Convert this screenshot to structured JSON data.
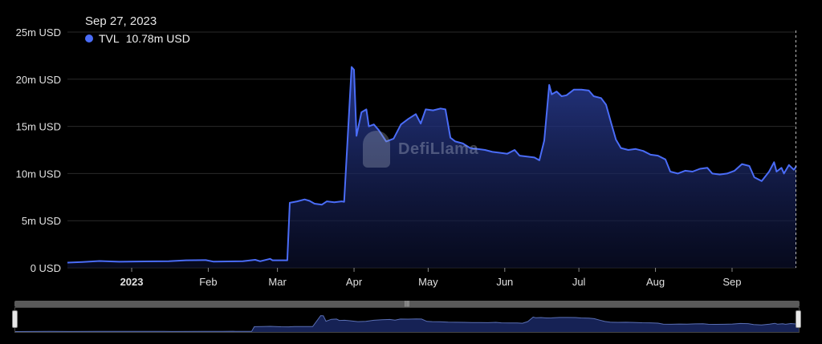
{
  "tooltip": {
    "date": "Sep 27, 2023",
    "series_name": "TVL",
    "value": "10.78m USD"
  },
  "watermark": {
    "text": "DefiLlama"
  },
  "colors": {
    "line": "#4a6cf7",
    "background": "#000000",
    "grid": "#2a2a2a",
    "slider": "#5a5a5a"
  },
  "chart_data": {
    "type": "area",
    "y_ticks": [
      {
        "value": 0,
        "label": "0 USD"
      },
      {
        "value": 5,
        "label": "5m USD"
      },
      {
        "value": 10,
        "label": "10m USD"
      },
      {
        "value": 15,
        "label": "15m USD"
      },
      {
        "value": 20,
        "label": "20m USD"
      },
      {
        "value": 25,
        "label": "25m USD"
      }
    ],
    "x_ticks": [
      {
        "day": 0,
        "label": "2023",
        "bold": true
      },
      {
        "day": 31,
        "label": "Feb"
      },
      {
        "day": 59,
        "label": "Mar"
      },
      {
        "day": 90,
        "label": "Apr"
      },
      {
        "day": 120,
        "label": "May"
      },
      {
        "day": 151,
        "label": "Jun"
      },
      {
        "day": 181,
        "label": "Jul"
      },
      {
        "day": 212,
        "label": "Aug"
      },
      {
        "day": 243,
        "label": "Sep"
      }
    ],
    "x_range": [
      -26,
      269
    ],
    "ylim": [
      0,
      25
    ],
    "grid": true,
    "series": [
      {
        "name": "TVL",
        "points": [
          [
            -26,
            0.55
          ],
          [
            -20,
            0.62
          ],
          [
            -13,
            0.72
          ],
          [
            -5,
            0.65
          ],
          [
            5,
            0.68
          ],
          [
            15,
            0.7
          ],
          [
            22,
            0.8
          ],
          [
            30,
            0.82
          ],
          [
            33,
            0.66
          ],
          [
            45,
            0.7
          ],
          [
            50,
            0.85
          ],
          [
            52,
            0.7
          ],
          [
            56,
            0.95
          ],
          [
            57,
            0.8
          ],
          [
            63,
            0.8
          ],
          [
            64,
            6.9
          ],
          [
            67,
            7.05
          ],
          [
            70,
            7.25
          ],
          [
            72,
            7.1
          ],
          [
            74,
            6.8
          ],
          [
            77,
            6.7
          ],
          [
            79,
            7.05
          ],
          [
            82,
            6.95
          ],
          [
            85,
            7.05
          ],
          [
            86,
            7.0
          ],
          [
            89,
            21.3
          ],
          [
            90,
            21.0
          ],
          [
            91,
            14.0
          ],
          [
            93,
            16.5
          ],
          [
            95,
            16.8
          ],
          [
            96,
            15.0
          ],
          [
            98,
            15.2
          ],
          [
            100,
            14.6
          ],
          [
            103,
            13.4
          ],
          [
            106,
            13.7
          ],
          [
            109,
            15.2
          ],
          [
            112,
            15.8
          ],
          [
            115,
            16.3
          ],
          [
            117,
            15.3
          ],
          [
            119,
            16.8
          ],
          [
            122,
            16.7
          ],
          [
            125,
            16.9
          ],
          [
            127,
            16.8
          ],
          [
            129,
            13.8
          ],
          [
            131,
            13.4
          ],
          [
            134,
            13.2
          ],
          [
            137,
            12.7
          ],
          [
            140,
            12.6
          ],
          [
            143,
            12.5
          ],
          [
            146,
            12.3
          ],
          [
            149,
            12.2
          ],
          [
            152,
            12.1
          ],
          [
            155,
            12.5
          ],
          [
            157,
            11.9
          ],
          [
            160,
            11.8
          ],
          [
            163,
            11.7
          ],
          [
            165,
            11.4
          ],
          [
            167,
            13.5
          ],
          [
            169,
            19.4
          ],
          [
            170,
            18.4
          ],
          [
            172,
            18.7
          ],
          [
            174,
            18.2
          ],
          [
            176,
            18.3
          ],
          [
            179,
            18.9
          ],
          [
            182,
            18.9
          ],
          [
            185,
            18.8
          ],
          [
            187,
            18.2
          ],
          [
            190,
            18.0
          ],
          [
            192,
            17.3
          ],
          [
            194,
            15.4
          ],
          [
            196,
            13.6
          ],
          [
            198,
            12.7
          ],
          [
            201,
            12.5
          ],
          [
            204,
            12.6
          ],
          [
            207,
            12.4
          ],
          [
            210,
            12.0
          ],
          [
            213,
            11.9
          ],
          [
            216,
            11.5
          ],
          [
            218,
            10.2
          ],
          [
            221,
            10.0
          ],
          [
            224,
            10.3
          ],
          [
            227,
            10.2
          ],
          [
            230,
            10.5
          ],
          [
            233,
            10.6
          ],
          [
            235,
            10.0
          ],
          [
            238,
            9.9
          ],
          [
            241,
            10.0
          ],
          [
            244,
            10.3
          ],
          [
            247,
            11.0
          ],
          [
            250,
            10.8
          ],
          [
            252,
            9.6
          ],
          [
            255,
            9.2
          ],
          [
            258,
            10.2
          ],
          [
            260,
            11.2
          ],
          [
            261,
            10.2
          ],
          [
            263,
            10.6
          ],
          [
            264,
            10.0
          ],
          [
            266,
            10.9
          ],
          [
            268,
            10.4
          ],
          [
            269,
            10.78
          ]
        ]
      }
    ]
  }
}
